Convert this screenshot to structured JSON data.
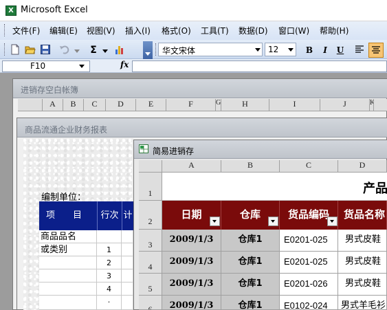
{
  "app": {
    "title": "Microsoft Excel",
    "icon_letter": "X"
  },
  "menu": [
    "文件(F)",
    "编辑(E)",
    "视图(V)",
    "插入(I)",
    "格式(O)",
    "工具(T)",
    "数据(D)",
    "窗口(W)",
    "帮助(H)"
  ],
  "toolbar": {
    "font": "华文宋体",
    "size": "12",
    "bold": "B",
    "italic": "I",
    "underline": "U",
    "sigma": "Σ"
  },
  "formula_bar": {
    "name_box": "F10",
    "fx": "fx",
    "formula": ""
  },
  "window1": {
    "title": "进销存空白帐簿",
    "col_headers": [
      "A",
      "B",
      "C",
      "D",
      "E",
      "F",
      "G",
      "H",
      "I",
      "J",
      "K"
    ]
  },
  "window2": {
    "title": "商品流通企业财务报表",
    "label": "编制单位：",
    "header": {
      "item": "项　　目",
      "row_no": "行次",
      "extra": "计"
    },
    "rows": [
      {
        "item": "商品品名",
        "no": ""
      },
      {
        "item": "或类别",
        "no": "1"
      },
      {
        "item": "",
        "no": "2"
      },
      {
        "item": "",
        "no": "3"
      },
      {
        "item": "",
        "no": "4"
      },
      {
        "item": "",
        "no": "·"
      }
    ]
  },
  "window3": {
    "title": "简易进销存",
    "col_headers": [
      "A",
      "B",
      "C",
      "D"
    ],
    "row_headers": [
      "1",
      "2",
      "3",
      "4",
      "5",
      "6"
    ],
    "title_text": "产品",
    "table_headers": [
      "日期",
      "仓库",
      "货品编码",
      "货品名称"
    ],
    "rows": [
      [
        "2009/1/3",
        "仓库1",
        "E0201-025",
        "男式皮鞋"
      ],
      [
        "2009/1/3",
        "仓库1",
        "E0201-025",
        "男式皮鞋"
      ],
      [
        "2009/1/3",
        "仓库1",
        "E0201-026",
        "男式皮鞋"
      ],
      [
        "2009/1/3",
        "仓库1",
        "E0102-024",
        "男式羊毛衫"
      ]
    ]
  }
}
